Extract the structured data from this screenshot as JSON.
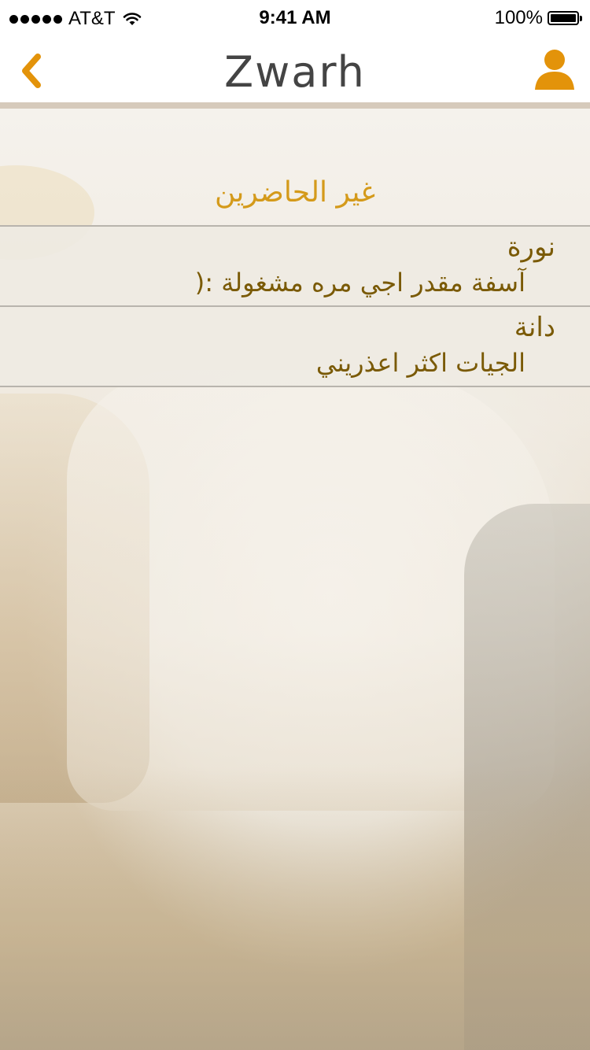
{
  "status_bar": {
    "carrier": "AT&T",
    "time": "9:41 AM",
    "battery": "100%"
  },
  "navbar": {
    "title": "Zwarh",
    "back_icon": "chevron-left-icon",
    "profile_icon": "user-icon",
    "accent_color": "#e3930a"
  },
  "section": {
    "title": "غير الحاضرين"
  },
  "absentees": [
    {
      "name": "نورة",
      "message": "آسفة مقدر اجي مره مشغولة :("
    },
    {
      "name": "دانة",
      "message": "الجيات اكثر اعذريني"
    }
  ]
}
